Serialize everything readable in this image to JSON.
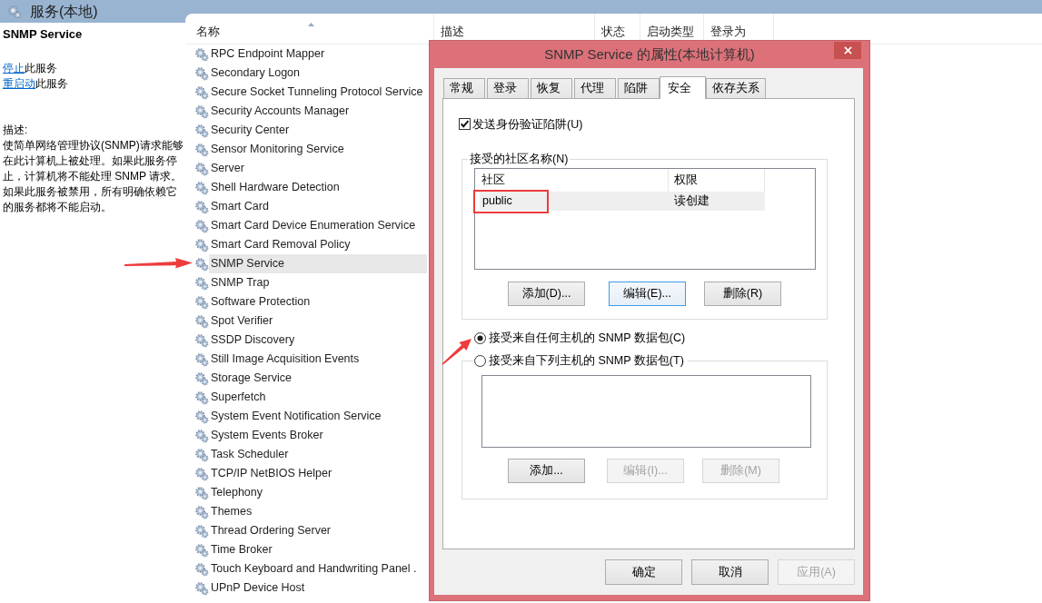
{
  "console": {
    "title": "服务(本地)"
  },
  "details": {
    "service_name": "SNMP Service",
    "actions": [
      {
        "link": "停止",
        "text": "此服务"
      },
      {
        "link": "重启动",
        "text": "此服务"
      }
    ],
    "description_label": "描述:",
    "description": "使简单网络管理协议(SNMP)请求能够在此计算机上被处理。如果此服务停止，计算机将不能处理 SNMP 请求。如果此服务被禁用，所有明确依赖它的服务都将不能启动。"
  },
  "services": {
    "columns": [
      {
        "label": "名称",
        "sorted": true
      },
      {
        "label": "描述",
        "sorted": false
      },
      {
        "label": "状态",
        "sorted": false
      },
      {
        "label": "启动类型",
        "sorted": false
      },
      {
        "label": "登录为",
        "sorted": false
      }
    ],
    "rows": [
      {
        "name": "RPC Endpoint Mapper",
        "selected": false
      },
      {
        "name": "Secondary Logon",
        "selected": false
      },
      {
        "name": "Secure Socket Tunneling Protocol Service",
        "selected": false
      },
      {
        "name": "Security Accounts Manager",
        "selected": false
      },
      {
        "name": "Security Center",
        "selected": false
      },
      {
        "name": "Sensor Monitoring Service",
        "selected": false
      },
      {
        "name": "Server",
        "selected": false
      },
      {
        "name": "Shell Hardware Detection",
        "selected": false
      },
      {
        "name": "Smart Card",
        "selected": false
      },
      {
        "name": "Smart Card Device Enumeration Service",
        "selected": false
      },
      {
        "name": "Smart Card Removal Policy",
        "selected": false
      },
      {
        "name": "SNMP Service",
        "selected": true
      },
      {
        "name": "SNMP Trap",
        "selected": false
      },
      {
        "name": "Software Protection",
        "selected": false
      },
      {
        "name": "Spot Verifier",
        "selected": false
      },
      {
        "name": "SSDP Discovery",
        "selected": false
      },
      {
        "name": "Still Image Acquisition Events",
        "selected": false
      },
      {
        "name": "Storage Service",
        "selected": false
      },
      {
        "name": "Superfetch",
        "selected": false
      },
      {
        "name": "System Event Notification Service",
        "selected": false
      },
      {
        "name": "System Events Broker",
        "selected": false
      },
      {
        "name": "Task Scheduler",
        "selected": false
      },
      {
        "name": "TCP/IP NetBIOS Helper",
        "selected": false
      },
      {
        "name": "Telephony",
        "selected": false
      },
      {
        "name": "Themes",
        "selected": false
      },
      {
        "name": "Thread Ordering Server",
        "selected": false
      },
      {
        "name": "Time Broker",
        "selected": false
      },
      {
        "name": "Touch Keyboard and Handwriting Panel .",
        "selected": false
      },
      {
        "name": "UPnP Device Host",
        "selected": false
      }
    ]
  },
  "dialog": {
    "title": "SNMP Service 的属性(本地计算机)",
    "tabs": [
      {
        "label": "常规",
        "selected": false
      },
      {
        "label": "登录",
        "selected": false
      },
      {
        "label": "恢复",
        "selected": false
      },
      {
        "label": "代理",
        "selected": false
      },
      {
        "label": "陷阱",
        "selected": false
      },
      {
        "label": "安全",
        "selected": true
      },
      {
        "label": "依存关系",
        "selected": false
      }
    ],
    "send_auth_trap": {
      "label": "发送身份验证陷阱(U)",
      "checked": true
    },
    "communities": {
      "legend": "接受的社区名称(N)",
      "columns": [
        "社区",
        "权限"
      ],
      "rows": [
        {
          "community": "public",
          "rights": "读创建",
          "selected": true
        }
      ],
      "buttons": [
        {
          "label": "添加(D)...",
          "disabled": false,
          "focused": false
        },
        {
          "label": "编辑(E)...",
          "disabled": false,
          "focused": true
        },
        {
          "label": "删除(R)",
          "disabled": false,
          "focused": false
        }
      ]
    },
    "accept_from": [
      {
        "label": "接受来自任何主机的 SNMP 数据包(C)",
        "selected": true
      },
      {
        "label": "接受来自下列主机的 SNMP 数据包(T)",
        "selected": false
      }
    ],
    "hosts": {
      "buttons": [
        {
          "label": "添加...",
          "disabled": false
        },
        {
          "label": "编辑(I)...",
          "disabled": true
        },
        {
          "label": "删除(M)",
          "disabled": true
        }
      ]
    },
    "footer_buttons": [
      {
        "label": "确定",
        "disabled": false
      },
      {
        "label": "取消",
        "disabled": false
      },
      {
        "label": "应用(A)",
        "disabled": true
      }
    ]
  }
}
